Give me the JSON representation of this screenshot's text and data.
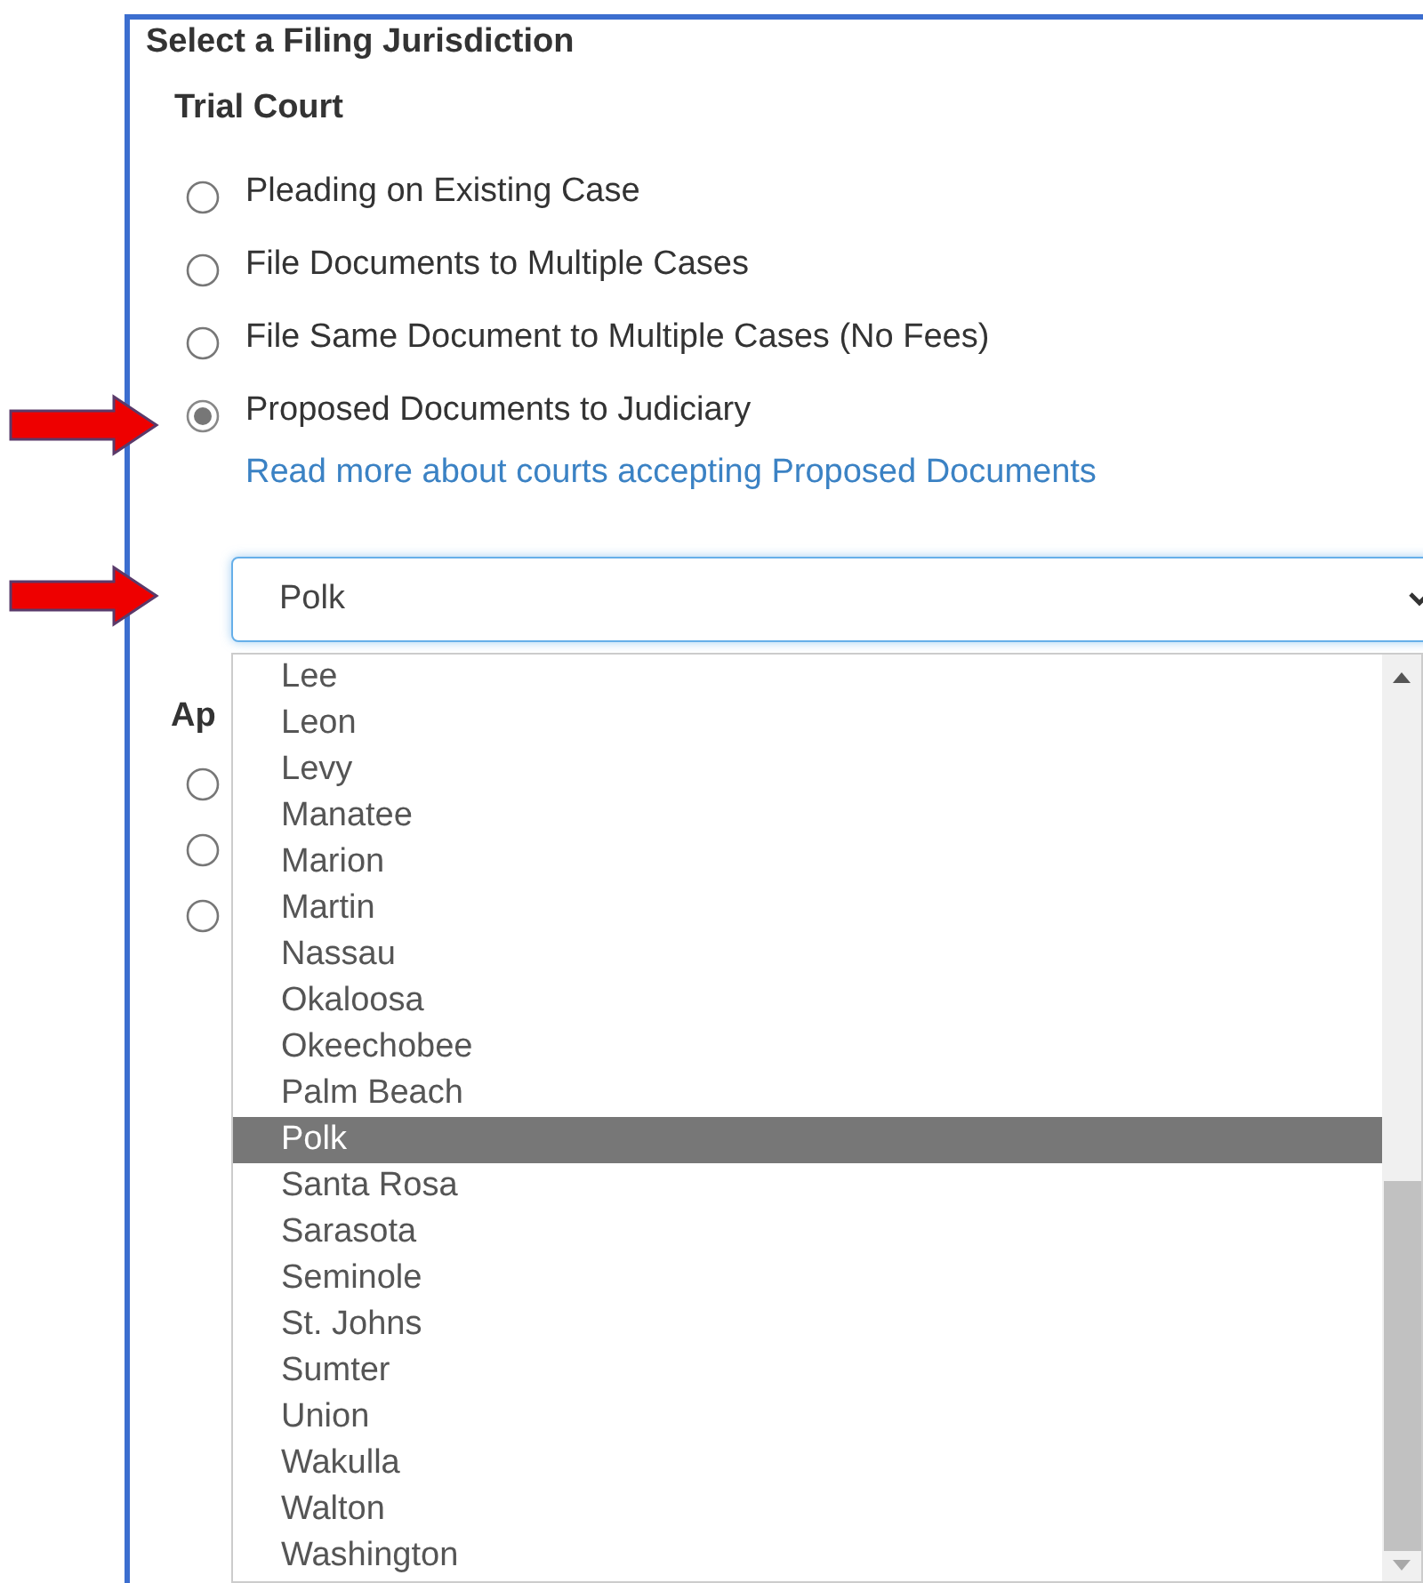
{
  "panel": {
    "title": "Select a Filing Jurisdiction"
  },
  "trial_court": {
    "heading": "Trial Court",
    "options": [
      {
        "label": "Pleading on Existing Case",
        "selected": false
      },
      {
        "label": "File Documents to Multiple Cases",
        "selected": false
      },
      {
        "label": "File Same Document to Multiple Cases (No Fees)",
        "selected": false
      },
      {
        "label": "Proposed Documents to Judiciary",
        "selected": true
      }
    ],
    "link": "Read more about courts accepting Proposed Documents",
    "county_select": {
      "value": "Polk",
      "expanded": true
    }
  },
  "dropdown": {
    "items": [
      {
        "label": "Lee",
        "selected": false
      },
      {
        "label": "Leon",
        "selected": false
      },
      {
        "label": "Levy",
        "selected": false
      },
      {
        "label": "Manatee",
        "selected": false
      },
      {
        "label": "Marion",
        "selected": false
      },
      {
        "label": "Martin",
        "selected": false
      },
      {
        "label": "Nassau",
        "selected": false
      },
      {
        "label": "Okaloosa",
        "selected": false
      },
      {
        "label": "Okeechobee",
        "selected": false
      },
      {
        "label": "Palm Beach",
        "selected": false
      },
      {
        "label": "Polk",
        "selected": true
      },
      {
        "label": "Santa Rosa",
        "selected": false
      },
      {
        "label": "Sarasota",
        "selected": false
      },
      {
        "label": "Seminole",
        "selected": false
      },
      {
        "label": "St. Johns",
        "selected": false
      },
      {
        "label": "Sumter",
        "selected": false
      },
      {
        "label": "Union",
        "selected": false
      },
      {
        "label": "Wakulla",
        "selected": false
      },
      {
        "label": "Walton",
        "selected": false
      },
      {
        "label": "Washington",
        "selected": false
      }
    ]
  },
  "appellate": {
    "heading": "Ap",
    "options": [
      {
        "selected": false
      },
      {
        "selected": false
      },
      {
        "selected": false
      }
    ]
  }
}
